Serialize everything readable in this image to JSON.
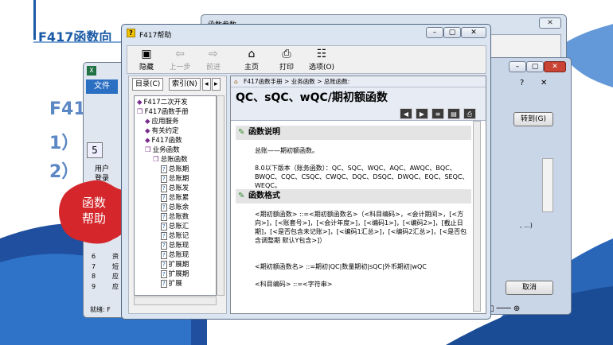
{
  "slide": {
    "title": "F417函数向",
    "big_f": "F41",
    "item1": "1）",
    "item2": "2）",
    "badge": [
      "函数",
      "帮助"
    ]
  },
  "back_window": {
    "title": "函数参数",
    "goto_button": "转到(G)",
    "cancel_button": "取消",
    "side_text": ", ...)",
    "help_glyph": "?"
  },
  "excel": {
    "file_tab": "文件",
    "user_label": "用户",
    "login_label": "登录",
    "rows": [
      "6",
      "7",
      "8",
      "9"
    ],
    "cells": [
      "资",
      "短",
      "应",
      "应"
    ],
    "status": "就绪: F"
  },
  "help": {
    "title": "F417帮助",
    "toolbar": [
      {
        "icon": "hide-icon",
        "glyph": "▣",
        "label": "隐藏",
        "enabled": true
      },
      {
        "icon": "back-icon",
        "glyph": "⇦",
        "label": "上一步",
        "enabled": false
      },
      {
        "icon": "forward-icon",
        "glyph": "⇨",
        "label": "前进",
        "enabled": false
      },
      {
        "icon": "home-icon",
        "glyph": "⌂",
        "label": "主页",
        "enabled": true
      },
      {
        "icon": "print-icon",
        "glyph": "⎙",
        "label": "打印",
        "enabled": true
      },
      {
        "icon": "options-icon",
        "glyph": "☷",
        "label": "选项(O)",
        "enabled": true
      }
    ],
    "tabs": [
      "目录(C)",
      "索引(N)"
    ],
    "tree": [
      {
        "label": "F417二次开发",
        "level": 0,
        "icon": "book"
      },
      {
        "label": "F417函数手册",
        "level": 0,
        "icon": "openbook"
      },
      {
        "label": "应用服务",
        "level": 1,
        "icon": "book"
      },
      {
        "label": "有关约定",
        "level": 1,
        "icon": "book"
      },
      {
        "label": "F417函数",
        "level": 1,
        "icon": "book"
      },
      {
        "label": "业务函数",
        "level": 1,
        "icon": "openbook"
      },
      {
        "label": "总账函数",
        "level": 2,
        "icon": "openbook"
      },
      {
        "label": "总账期",
        "level": 3,
        "icon": "page"
      },
      {
        "label": "总账期",
        "level": 3,
        "icon": "page"
      },
      {
        "label": "总账发",
        "level": 3,
        "icon": "page"
      },
      {
        "label": "总账累",
        "level": 3,
        "icon": "page"
      },
      {
        "label": "总账余",
        "level": 3,
        "icon": "page"
      },
      {
        "label": "总账数",
        "level": 3,
        "icon": "page"
      },
      {
        "label": "总账汇",
        "level": 3,
        "icon": "page"
      },
      {
        "label": "总账记",
        "level": 3,
        "icon": "page"
      },
      {
        "label": "总账现",
        "level": 3,
        "icon": "page"
      },
      {
        "label": "总账现",
        "level": 3,
        "icon": "page"
      },
      {
        "label": "扩展期",
        "level": 3,
        "icon": "page"
      },
      {
        "label": "扩展期",
        "level": 3,
        "icon": "page"
      },
      {
        "label": "扩展",
        "level": 3,
        "icon": "page"
      }
    ],
    "breadcrumb": "F417函数手册 > 业务函数 > 总账函数:",
    "topic_title": "QC、sQC、wQC/期初额函数",
    "nav_buttons": [
      "◀",
      "▶",
      "≡",
      "▤",
      "⎙"
    ],
    "sections": [
      {
        "heading": "函数说明",
        "paragraphs": [
          "总账——期初额函数。",
          "8.0以下版本（账务函数）：QC、SQC、WQC、AQC、AWQC、BQC、BWQC、CQC、CSQC、CWQC、DQC、DSQC、DWQC、EQC、SEQC、WEQC。"
        ]
      },
      {
        "heading": "函数格式",
        "paragraphs": [
          "<期初额函数> ::=<期初额函数名>（<科目编码>，<会计期间>，[<方向>]，[<账套号>]，[<会计年度>]，[<编码1>]，[<编码2>]，[截止日期]，[<是否包含未记账>]，[<编码1汇总>]，[<编码2汇总>]，[<是否包含调整期 默认Y包含>]）",
          "<期初额函数名> ::=期初|QC|数量期初|sQC|外币期初|wQC",
          "<科目编码> ::=<字符串>"
        ]
      }
    ]
  }
}
